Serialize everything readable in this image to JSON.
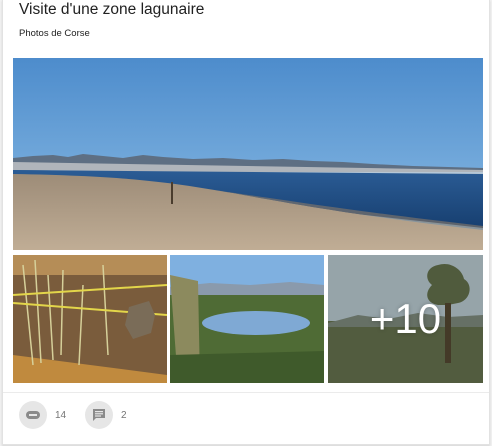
{
  "post": {
    "title": "Visite d'une zone lagunaire",
    "subtitle": "Photos de Corse",
    "more_photos": "+10"
  },
  "actions": {
    "plus_count": "14",
    "comment_count": "2"
  },
  "icons": {
    "plus_one": "plus-one-icon",
    "comment": "comment-icon"
  },
  "colors": {
    "sky": "#5d9ad6",
    "sea": "#1f4d86",
    "sand": "#b29f88"
  }
}
